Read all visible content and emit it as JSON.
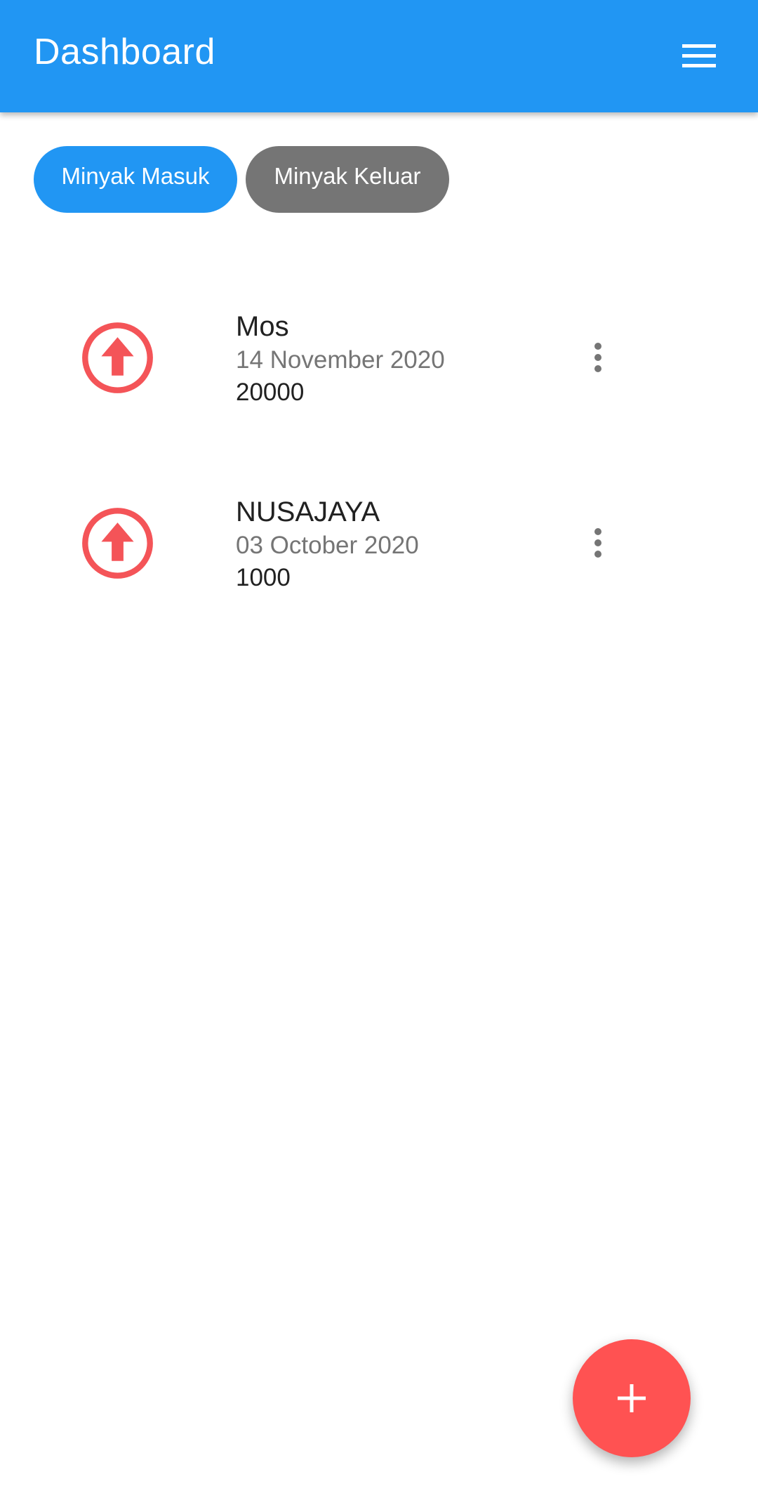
{
  "app_bar": {
    "title": "Dashboard",
    "menu_icon": "hamburger-menu-icon",
    "background_color": "#2196F3"
  },
  "filters": {
    "masuk_label": "Minyak Masuk",
    "keluar_label": "Minyak Keluar",
    "active_color": "#2196F3",
    "inactive_color": "#757575"
  },
  "items": [
    {
      "name": "Mos",
      "date": "14 November 2020",
      "amount": "20000",
      "icon": "arrow-up-circle-icon",
      "more_icon": "more-vert-icon"
    },
    {
      "name": "NUSAJAYA",
      "date": "03 October 2020",
      "amount": "1000",
      "icon": "arrow-up-circle-icon",
      "more_icon": "more-vert-icon"
    }
  ],
  "fab": {
    "icon": "plus-icon",
    "color": "#FF5252"
  },
  "accent_red": "#F45458"
}
